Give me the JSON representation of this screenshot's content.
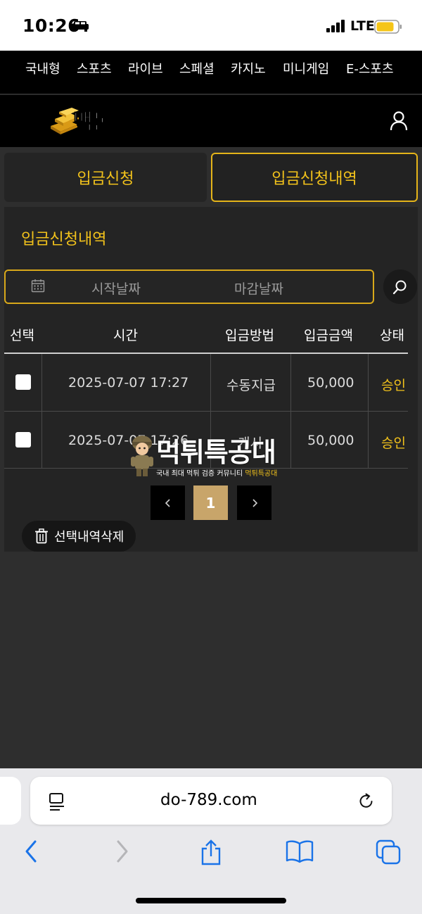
{
  "status_bar": {
    "time": "10:26",
    "network": "LTE",
    "battery_color": "#f5c518"
  },
  "top_nav": {
    "items": [
      "국내형",
      "스포츠",
      "라이브",
      "스페셜",
      "카지노",
      "미니게임",
      "E-스포츠"
    ]
  },
  "header": {
    "logo_text": "백돈"
  },
  "tabs": {
    "request": "입금신청",
    "history": "입금신청내역"
  },
  "panel": {
    "title": "입금신청내역",
    "date_start_placeholder": "시작날짜",
    "date_end_placeholder": "마감날짜"
  },
  "table": {
    "headers": [
      "선택",
      "시간",
      "입금방법",
      "입금금액",
      "상태"
    ],
    "rows": [
      {
        "time": "2025-07-07 17:27",
        "method": "수동지급",
        "amount": "50,000",
        "status": "승인"
      },
      {
        "time": "2025-07-07 17:26",
        "method": "캐시",
        "amount": "50,000",
        "status": "승인"
      }
    ]
  },
  "pagination": {
    "prev": "‹",
    "current": "1",
    "next": "›"
  },
  "actions": {
    "delete_selected": "선택내역삭제"
  },
  "watermark": {
    "title": "먹튀특공대",
    "subtitle": "국내 최대 먹튀 검증 커뮤니티",
    "subtitle_brand": "먹튀특공대"
  },
  "browser": {
    "url": "do-789.com"
  },
  "colors": {
    "accent": "#f2c21b",
    "page_bg": "#2e2e2e",
    "panel_bg": "#242424"
  }
}
